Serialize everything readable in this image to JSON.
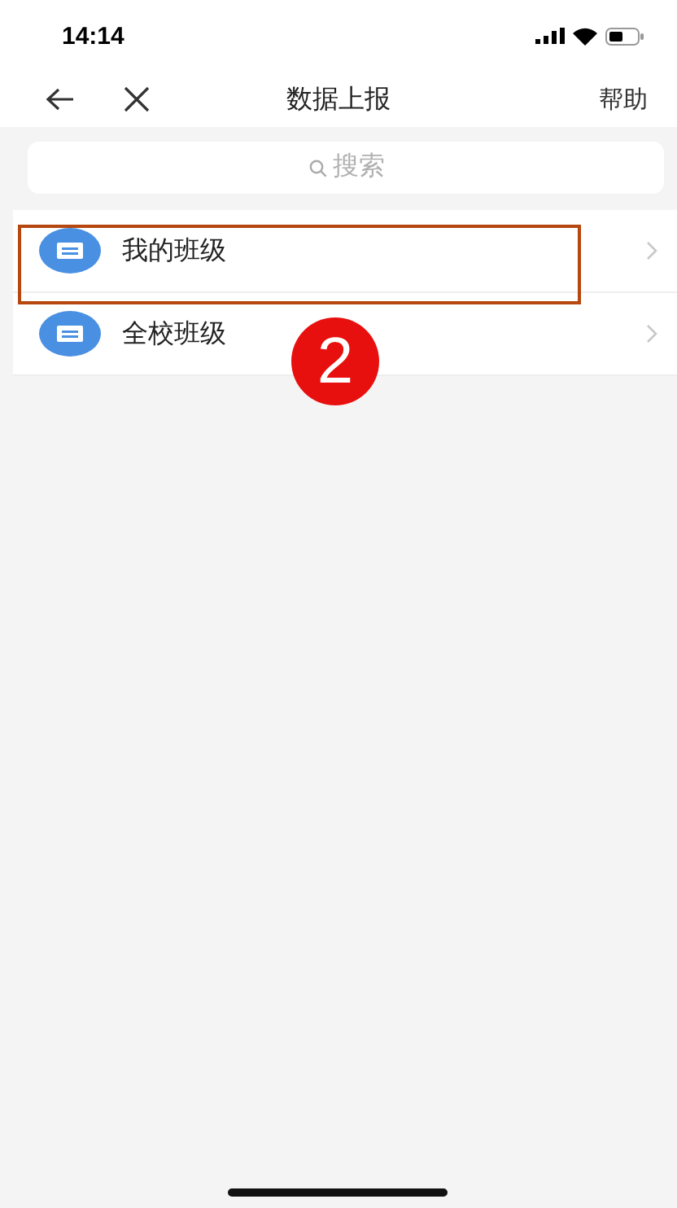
{
  "status_bar": {
    "time": "14:14"
  },
  "nav_bar": {
    "title": "数据上报",
    "action": "帮助"
  },
  "search": {
    "placeholder": "搜索"
  },
  "list": [
    {
      "label": "我的班级",
      "highlighted": true
    },
    {
      "label": "全校班级",
      "highlighted": false
    }
  ],
  "annotation": {
    "label": "2"
  }
}
